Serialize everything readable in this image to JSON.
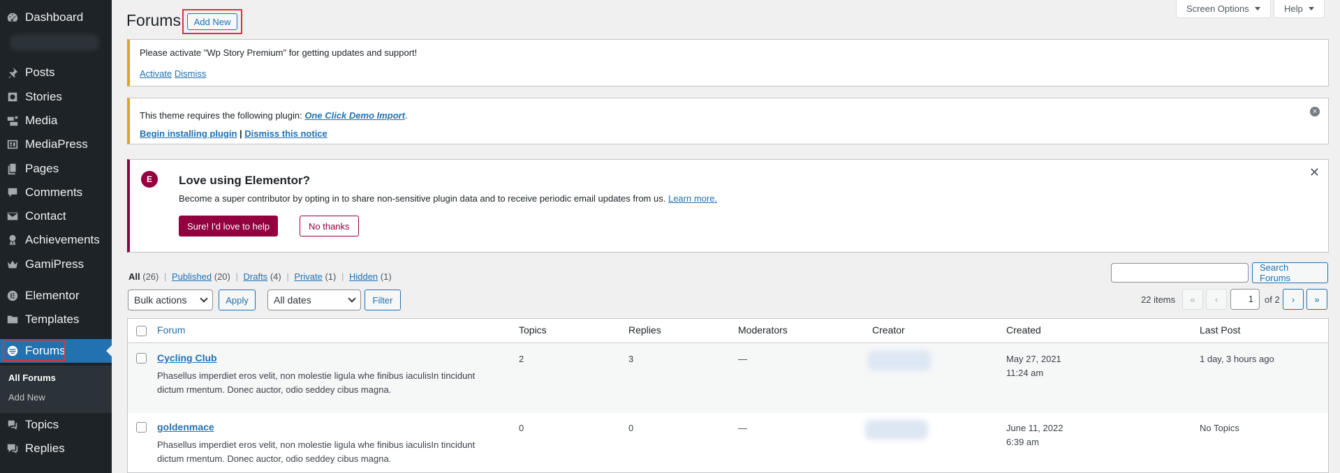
{
  "sidebar": {
    "items": [
      {
        "label": "Dashboard",
        "icon": "dashboard-icon"
      },
      {
        "label": "Posts",
        "icon": "pushpin-icon"
      },
      {
        "label": "Stories",
        "icon": "stories-icon"
      },
      {
        "label": "Media",
        "icon": "media-icon"
      },
      {
        "label": "MediaPress",
        "icon": "mediapress-icon"
      },
      {
        "label": "Pages",
        "icon": "pages-icon"
      },
      {
        "label": "Comments",
        "icon": "comment-icon"
      },
      {
        "label": "Contact",
        "icon": "mail-icon"
      },
      {
        "label": "Achievements",
        "icon": "award-icon"
      },
      {
        "label": "GamiPress",
        "icon": "crown-icon"
      },
      {
        "label": "Elementor",
        "icon": "elementor-icon"
      },
      {
        "label": "Templates",
        "icon": "folder-icon"
      },
      {
        "label": "Forums",
        "icon": "forums-icon"
      },
      {
        "label": "Topics",
        "icon": "topics-icon"
      },
      {
        "label": "Replies",
        "icon": "replies-icon"
      }
    ],
    "submenu": [
      "All Forums",
      "Add New"
    ]
  },
  "header": {
    "title": "Forums",
    "add_new": "Add New",
    "screen_options": "Screen Options",
    "help": "Help"
  },
  "notices": {
    "story": {
      "text": "Please activate \"Wp Story Premium\" for getting updates and support!",
      "activate": "Activate",
      "dismiss": "Dismiss"
    },
    "theme": {
      "text": "This theme requires the following plugin:",
      "plugin": "One Click Demo Import",
      "period": ".",
      "begin": "Begin installing plugin",
      "sep": "|",
      "dismiss": "Dismiss this notice"
    },
    "elementor": {
      "logo": "E",
      "title": "Love using Elementor?",
      "text": "Become a super contributor by opting in to share non-sensitive plugin data and to receive periodic email updates from us.",
      "learn_more": "Learn more.",
      "yes": "Sure! I'd love to help",
      "no": "No thanks",
      "close": "✕"
    }
  },
  "filters": {
    "views": [
      {
        "label": "All",
        "count": "(26)"
      },
      {
        "label": "Published",
        "count": "(20)"
      },
      {
        "label": "Drafts",
        "count": "(4)"
      },
      {
        "label": "Private",
        "count": "(1)"
      },
      {
        "label": "Hidden",
        "count": "(1)"
      }
    ],
    "sep": "|",
    "bulk_actions": "Bulk actions",
    "apply": "Apply",
    "all_dates": "All dates",
    "filter": "Filter",
    "search_button": "Search Forums",
    "search_value": ""
  },
  "pagination": {
    "items": "22 items",
    "first": "«",
    "prev": "‹",
    "current": "1",
    "of": "of 2",
    "next": "›",
    "last": "»"
  },
  "table": {
    "columns": [
      "Forum",
      "Topics",
      "Replies",
      "Moderators",
      "Creator",
      "Created",
      "Last Post"
    ],
    "rows": [
      {
        "title": "Cycling Club",
        "desc": "Phasellus imperdiet eros velit, non molestie ligula whe finibus iaculisIn tincidunt dictum rmentum. Donec auctor, odio seddey cibus magna.",
        "topics": "2",
        "replies": "3",
        "moderators": "—",
        "created_date": "May 27, 2021",
        "created_time": "11:24 am",
        "last_post": "1 day, 3 hours ago"
      },
      {
        "title": "goldenmace",
        "desc": "Phasellus imperdiet eros velit, non molestie ligula whe finibus iaculisIn tincidunt dictum rmentum. Donec auctor, odio seddey cibus magna.",
        "topics": "0",
        "replies": "0",
        "moderators": "—",
        "created_date": "June 11, 2022",
        "created_time": "6:39 am",
        "last_post": "No Topics"
      }
    ]
  },
  "colors": {
    "sidebar_bg": "#1d2327",
    "active": "#2271b1",
    "highlight_box": "#d63638",
    "elementor": "#93003f",
    "warning": "#dba617"
  }
}
